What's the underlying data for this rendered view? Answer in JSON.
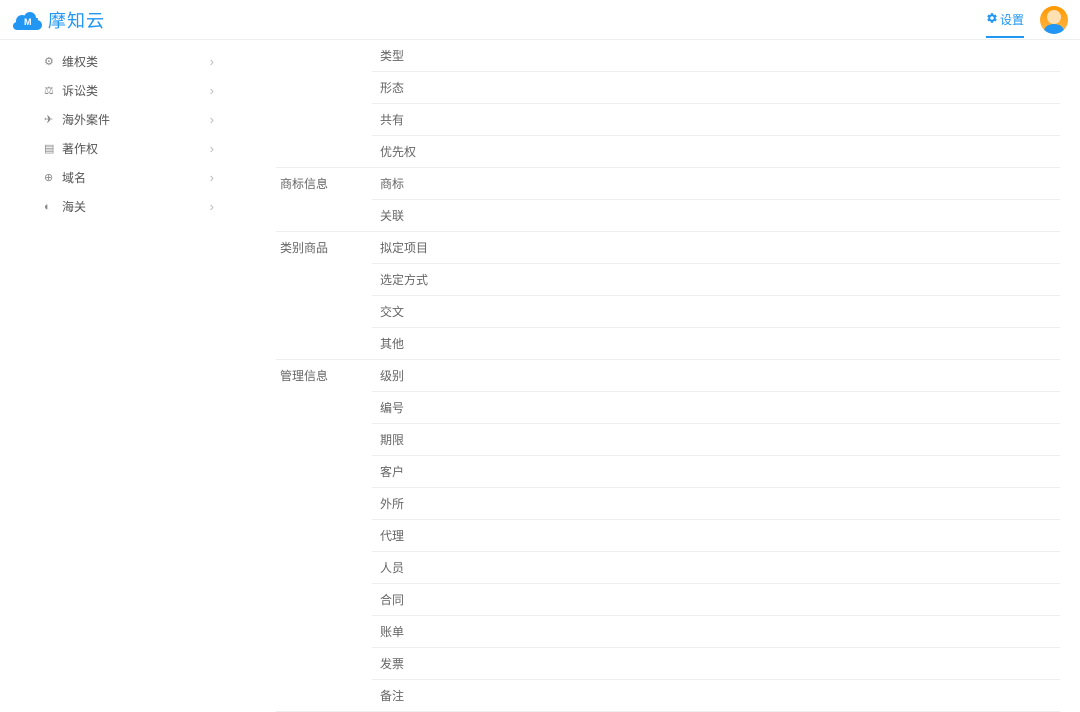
{
  "header": {
    "brand": "摩知云",
    "settings_label": "设置"
  },
  "sidebar": {
    "items": [
      {
        "label": "维权类",
        "icon": "⚙"
      },
      {
        "label": "诉讼类",
        "icon": "⚖"
      },
      {
        "label": "海外案件",
        "icon": "✈"
      },
      {
        "label": "著作权",
        "icon": "▤"
      },
      {
        "label": "域名",
        "icon": "⊕"
      },
      {
        "label": "海关",
        "icon": "◐"
      }
    ]
  },
  "sections": [
    {
      "name": "",
      "rows": [
        "类型",
        "形态",
        "共有",
        "优先权"
      ]
    },
    {
      "name": "商标信息",
      "rows": [
        "商标",
        "关联"
      ]
    },
    {
      "name": "类别商品",
      "rows": [
        "拟定项目",
        "选定方式",
        "交文",
        "其他"
      ]
    },
    {
      "name": "管理信息",
      "rows": [
        "级别",
        "编号",
        "期限",
        "客户",
        "外所",
        "代理",
        "人员",
        "合同",
        "账单",
        "发票",
        "备注"
      ]
    }
  ]
}
